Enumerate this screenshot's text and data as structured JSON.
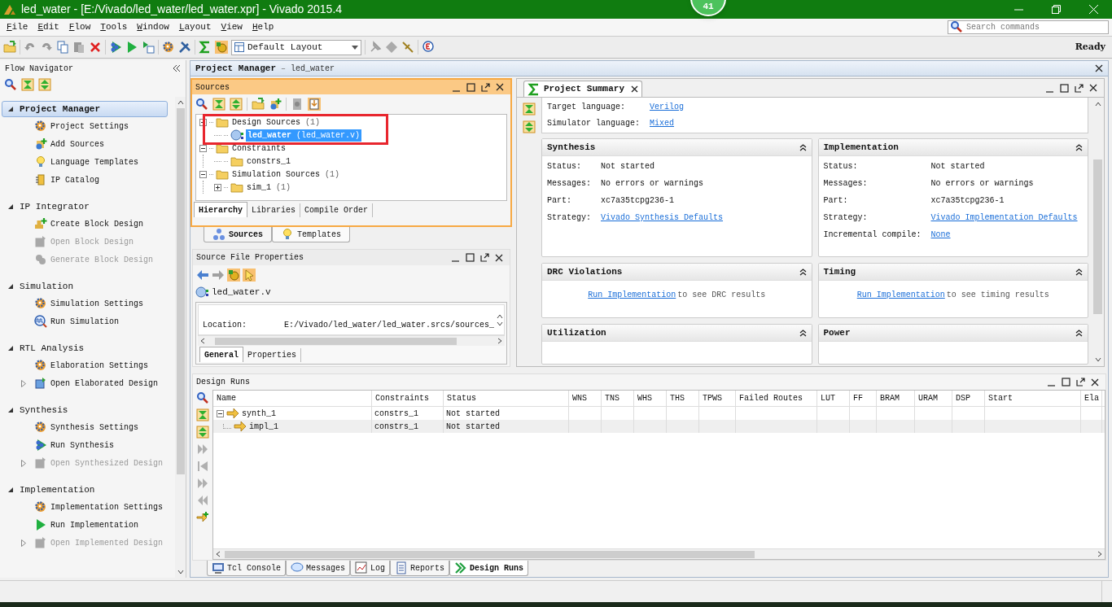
{
  "window": {
    "title": "led_water - [E:/Vivado/led_water/led_water.xpr] - Vivado 2015.4",
    "badge": "41"
  },
  "menu": [
    "File",
    "Edit",
    "Flow",
    "Tools",
    "Window",
    "Layout",
    "View",
    "Help"
  ],
  "search": {
    "placeholder": "Search commands"
  },
  "toolbar": {
    "layout": "Default Layout",
    "status": "Ready"
  },
  "flow_navigator": {
    "title": "Flow Navigator",
    "sections": [
      {
        "label": "Project Manager",
        "selected": true,
        "expanded": true,
        "items": [
          {
            "label": "Project Settings",
            "kind": "settings",
            "disabled": false,
            "expandable": false
          },
          {
            "label": "Add Sources",
            "kind": "add",
            "disabled": false,
            "expandable": false
          },
          {
            "label": "Language Templates",
            "kind": "template",
            "disabled": false,
            "expandable": false
          },
          {
            "label": "IP Catalog",
            "kind": "catalog",
            "disabled": false,
            "expandable": false
          }
        ]
      },
      {
        "label": "IP Integrator",
        "selected": false,
        "expanded": true,
        "items": [
          {
            "label": "Create Block Design",
            "kind": "create",
            "disabled": false,
            "expandable": false
          },
          {
            "label": "Open Block Design",
            "kind": "open",
            "disabled": true,
            "expandable": false
          },
          {
            "label": "Generate Block Design",
            "kind": "generate",
            "disabled": true,
            "expandable": false
          }
        ]
      },
      {
        "label": "Simulation",
        "selected": false,
        "expanded": true,
        "items": [
          {
            "label": "Simulation Settings",
            "kind": "settings",
            "disabled": false,
            "expandable": false
          },
          {
            "label": "Run Simulation",
            "kind": "simulate",
            "disabled": false,
            "expandable": false
          }
        ]
      },
      {
        "label": "RTL Analysis",
        "selected": false,
        "expanded": true,
        "items": [
          {
            "label": "Elaboration Settings",
            "kind": "settings",
            "disabled": false,
            "expandable": false
          },
          {
            "label": "Open Elaborated Design",
            "kind": "open",
            "disabled": false,
            "expandable": true
          }
        ]
      },
      {
        "label": "Synthesis",
        "selected": false,
        "expanded": true,
        "items": [
          {
            "label": "Synthesis Settings",
            "kind": "settings",
            "disabled": false,
            "expandable": false
          },
          {
            "label": "Run Synthesis",
            "kind": "synth",
            "disabled": false,
            "expandable": false
          },
          {
            "label": "Open Synthesized Design",
            "kind": "open",
            "disabled": true,
            "expandable": true
          }
        ]
      },
      {
        "label": "Implementation",
        "selected": false,
        "expanded": true,
        "items": [
          {
            "label": "Implementation Settings",
            "kind": "settings",
            "disabled": false,
            "expandable": false
          },
          {
            "label": "Run Implementation",
            "kind": "run",
            "disabled": false,
            "expandable": false
          },
          {
            "label": "Open Implemented Design",
            "kind": "open",
            "disabled": true,
            "expandable": true
          }
        ]
      }
    ]
  },
  "project_manager": {
    "title": "Project Manager",
    "separator": "–",
    "project": "led_water"
  },
  "sources": {
    "title": "Sources",
    "tree": [
      {
        "label": "Design Sources",
        "count": "(1)",
        "kind": "folder",
        "expanded": true,
        "selected": false,
        "children": [
          {
            "label": "led_water",
            "count": "(led_water.v)",
            "kind": "module",
            "selected": true
          }
        ]
      },
      {
        "label": "Constraints",
        "kind": "folder",
        "expanded": true,
        "selected": false,
        "children": [
          {
            "label": "constrs_1",
            "kind": "folder",
            "selected": false
          }
        ]
      },
      {
        "label": "Simulation Sources",
        "count": "(1)",
        "kind": "folder",
        "expanded": true,
        "selected": false,
        "children": [
          {
            "label": "sim_1",
            "count": "(1)",
            "kind": "folder",
            "expanded": false,
            "selected": false
          }
        ]
      }
    ],
    "tabs": [
      {
        "label": "Hierarchy",
        "selected": true
      },
      {
        "label": "Libraries",
        "selected": false
      },
      {
        "label": "Compile Order",
        "selected": false
      }
    ],
    "bottom_tabs": [
      {
        "label": "Sources",
        "selected": true
      },
      {
        "label": "Templates",
        "selected": false
      }
    ]
  },
  "source_file_properties": {
    "title": "Source File Properties",
    "file": "led_water.v",
    "location_label": "Location:",
    "location": "E:/Vivado/led_water/led_water.srcs/sources_",
    "tabs": [
      {
        "label": "General",
        "selected": true
      },
      {
        "label": "Properties",
        "selected": false
      }
    ]
  },
  "project_summary": {
    "tab": "Project Summary",
    "top": [
      {
        "label": "Target language:",
        "value": "Verilog",
        "link": true
      },
      {
        "label": "Simulator language:",
        "value": "Mixed",
        "link": true
      }
    ],
    "cards": [
      {
        "title": "Synthesis",
        "kind": "fields",
        "rows": [
          {
            "label": "Status:",
            "value": "Not started",
            "link": false
          },
          {
            "label": "Messages:",
            "value": "No errors or warnings",
            "link": false
          },
          {
            "label": "Part:",
            "value": "xc7a35tcpg236-1",
            "link": false
          },
          {
            "label": "Strategy:",
            "value": "Vivado Synthesis Defaults",
            "link": true
          }
        ]
      },
      {
        "title": "Implementation",
        "kind": "fields",
        "rows": [
          {
            "label": "Status:",
            "value": "Not started",
            "link": false
          },
          {
            "label": "Messages:",
            "value": "No errors or warnings",
            "link": false
          },
          {
            "label": "Part:",
            "value": "xc7a35tcpg236-1",
            "link": false
          },
          {
            "label": "Strategy:",
            "value": "Vivado Implementation Defaults",
            "link": true
          },
          {
            "label": "Incremental compile:",
            "value": "None",
            "link": true
          }
        ]
      },
      {
        "title": "DRC Violations",
        "kind": "message",
        "link": "Run Implementation",
        "text": "to see DRC results"
      },
      {
        "title": "Timing",
        "kind": "message",
        "link": "Run Implementation",
        "text": "to see timing results"
      },
      {
        "title": "Utilization",
        "kind": "empty"
      },
      {
        "title": "Power",
        "kind": "empty"
      }
    ]
  },
  "design_runs": {
    "title": "Design Runs",
    "columns": [
      "Name",
      "Constraints",
      "Status",
      "WNS",
      "TNS",
      "WHS",
      "THS",
      "TPWS",
      "Failed Routes",
      "LUT",
      "FF",
      "BRAM",
      "URAM",
      "DSP",
      "Start",
      "Ela"
    ],
    "rows": [
      {
        "name": "synth_1",
        "constraints": "constrs_1",
        "status": "Not started",
        "expanded": true,
        "children": [
          {
            "name": "impl_1",
            "constraints": "constrs_1",
            "status": "Not started"
          }
        ]
      }
    ]
  },
  "bottom_tabs": [
    {
      "label": "Tcl Console",
      "kind": "console",
      "selected": false
    },
    {
      "label": "Messages",
      "kind": "messages",
      "selected": false
    },
    {
      "label": "Log",
      "kind": "log",
      "selected": false
    },
    {
      "label": "Reports",
      "kind": "reports",
      "selected": false
    },
    {
      "label": "Design Runs",
      "kind": "runs",
      "selected": true
    }
  ]
}
